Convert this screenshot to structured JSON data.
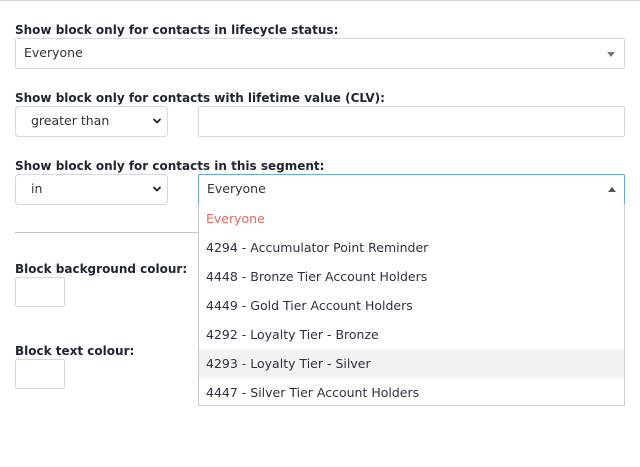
{
  "lifecycle": {
    "label": "Show block only for contacts in lifecycle status:",
    "value": "Everyone",
    "caret": "chevron-down-icon"
  },
  "clv": {
    "label": "Show block only for contacts with lifetime value (CLV):",
    "operator": "greater than",
    "value": ""
  },
  "segment": {
    "label": "Show block only for contacts in this segment:",
    "operator": "in",
    "value": "Everyone",
    "options": [
      "Everyone",
      "4294 - Accumulator Point Reminder",
      "4448 - Bronze Tier Account Holders",
      "4449 - Gold Tier Account Holders",
      "4292 - Loyalty Tier - Bronze",
      "4293 - Loyalty Tier - Silver",
      "4447 - Silver Tier Account Holders"
    ],
    "selected_option": "Everyone",
    "hovered_option": "4293 - Loyalty Tier - Silver"
  },
  "background_colour": {
    "label": "Block background colour:"
  },
  "text_colour": {
    "label": "Block text colour:"
  },
  "colors": {
    "accent_selected": "#e06a5e",
    "focus_border": "#6aa6e0",
    "hover_bg": "#f2f2f3"
  }
}
